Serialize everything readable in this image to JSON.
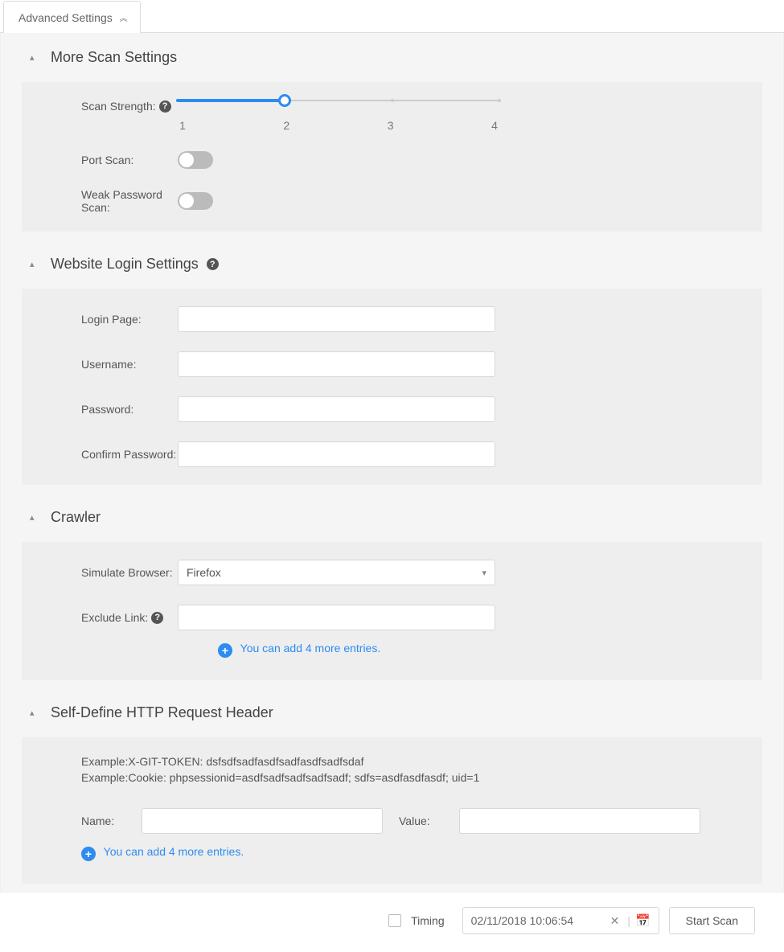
{
  "tab": {
    "label": "Advanced Settings"
  },
  "sections": {
    "scan": {
      "title": "More Scan Settings",
      "strength_label": "Scan Strength:",
      "port_label": "Port Scan:",
      "weak_pw_label": "Weak Password Scan:",
      "slider": {
        "min": 1,
        "max": 4,
        "value": 2,
        "ticks": {
          "t1": "1",
          "t2": "2",
          "t3": "3",
          "t4": "4"
        }
      },
      "port_scan": false,
      "weak_pw_scan": false
    },
    "login": {
      "title": "Website Login Settings",
      "login_page_label": "Login Page:",
      "username_label": "Username:",
      "password_label": "Password:",
      "confirm_label": "Confirm Password:",
      "login_page": "",
      "username": "",
      "password": "",
      "confirm": ""
    },
    "crawler": {
      "title": "Crawler",
      "browser_label": "Simulate Browser:",
      "browser_selected": "Firefox",
      "exclude_label": "Exclude Link:",
      "exclude_value": "",
      "add_text": "You can add 4 more entries."
    },
    "http": {
      "title": "Self-Define HTTP Request Header",
      "example1": "Example:X-GIT-TOKEN: dsfsdfsadfasdfsadfasdfsadfsdaf",
      "example2": "Example:Cookie: phpsessionid=asdfsadfsadfsadfsadf; sdfs=asdfasdfasdf; uid=1",
      "name_label": "Name:",
      "value_label": "Value:",
      "name_val": "",
      "value_val": "",
      "add_text": "You can add 4 more entries."
    }
  },
  "footer": {
    "timing_label": "Timing",
    "timing_checked": false,
    "datetime": "02/11/2018 10:06:54",
    "start_scan": "Start Scan"
  }
}
